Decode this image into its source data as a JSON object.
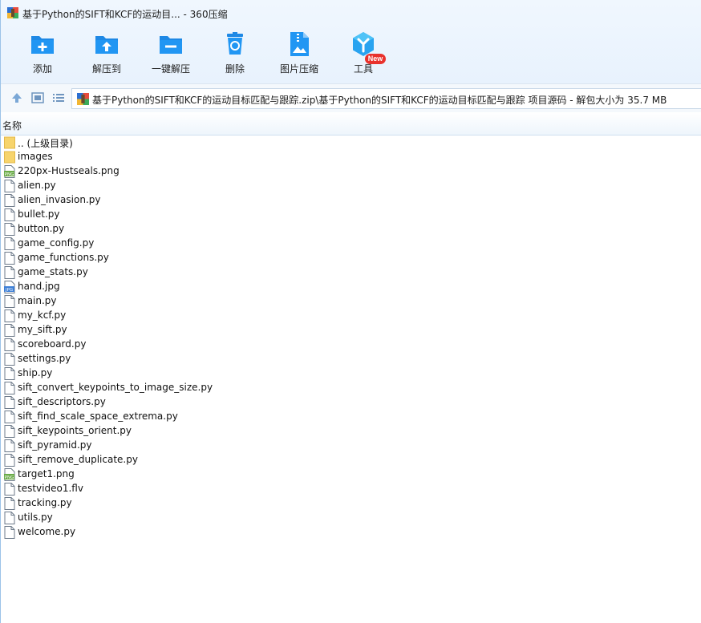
{
  "window": {
    "title": "基于Python的SIFT和KCF的运动目... - 360压缩"
  },
  "toolbar": {
    "buttons": [
      {
        "label": "添加",
        "icon": "add-icon"
      },
      {
        "label": "解压到",
        "icon": "extract-to-icon"
      },
      {
        "label": "一键解压",
        "icon": "one-click-extract-icon"
      },
      {
        "label": "删除",
        "icon": "delete-icon"
      },
      {
        "label": "图片压缩",
        "icon": "image-compress-icon"
      },
      {
        "label": "工具",
        "icon": "tools-icon"
      }
    ],
    "new_badge": "New"
  },
  "navbar": {
    "path": "基于Python的SIFT和KCF的运动目标匹配与跟踪.zip\\基于Python的SIFT和KCF的运动目标匹配与跟踪 项目源码 - 解包大小为 35.7 MB"
  },
  "list": {
    "column_name": "名称",
    "files": [
      {
        "name": ".. (上级目录)",
        "type": "folder"
      },
      {
        "name": "images",
        "type": "folder"
      },
      {
        "name": "220px-Hustseals.png",
        "type": "png"
      },
      {
        "name": "alien.py",
        "type": "file"
      },
      {
        "name": "alien_invasion.py",
        "type": "file"
      },
      {
        "name": "bullet.py",
        "type": "file"
      },
      {
        "name": "button.py",
        "type": "file"
      },
      {
        "name": "game_config.py",
        "type": "file"
      },
      {
        "name": "game_functions.py",
        "type": "file"
      },
      {
        "name": "game_stats.py",
        "type": "file"
      },
      {
        "name": "hand.jpg",
        "type": "jpg"
      },
      {
        "name": "main.py",
        "type": "file"
      },
      {
        "name": "my_kcf.py",
        "type": "file"
      },
      {
        "name": "my_sift.py",
        "type": "file"
      },
      {
        "name": "scoreboard.py",
        "type": "file"
      },
      {
        "name": "settings.py",
        "type": "file"
      },
      {
        "name": "ship.py",
        "type": "file"
      },
      {
        "name": "sift_convert_keypoints_to_image_size.py",
        "type": "file"
      },
      {
        "name": "sift_descriptors.py",
        "type": "file"
      },
      {
        "name": "sift_find_scale_space_extrema.py",
        "type": "file"
      },
      {
        "name": "sift_keypoints_orient.py",
        "type": "file"
      },
      {
        "name": "sift_pyramid.py",
        "type": "file"
      },
      {
        "name": "sift_remove_duplicate.py",
        "type": "file"
      },
      {
        "name": "target1.png",
        "type": "png"
      },
      {
        "name": "testvideo1.flv",
        "type": "file"
      },
      {
        "name": "tracking.py",
        "type": "file"
      },
      {
        "name": "utils.py",
        "type": "file"
      },
      {
        "name": "welcome.py",
        "type": "file"
      }
    ]
  },
  "colors": {
    "accent": "#1e88e5",
    "folder": "#f7d46c",
    "badge": "#e9322d"
  }
}
